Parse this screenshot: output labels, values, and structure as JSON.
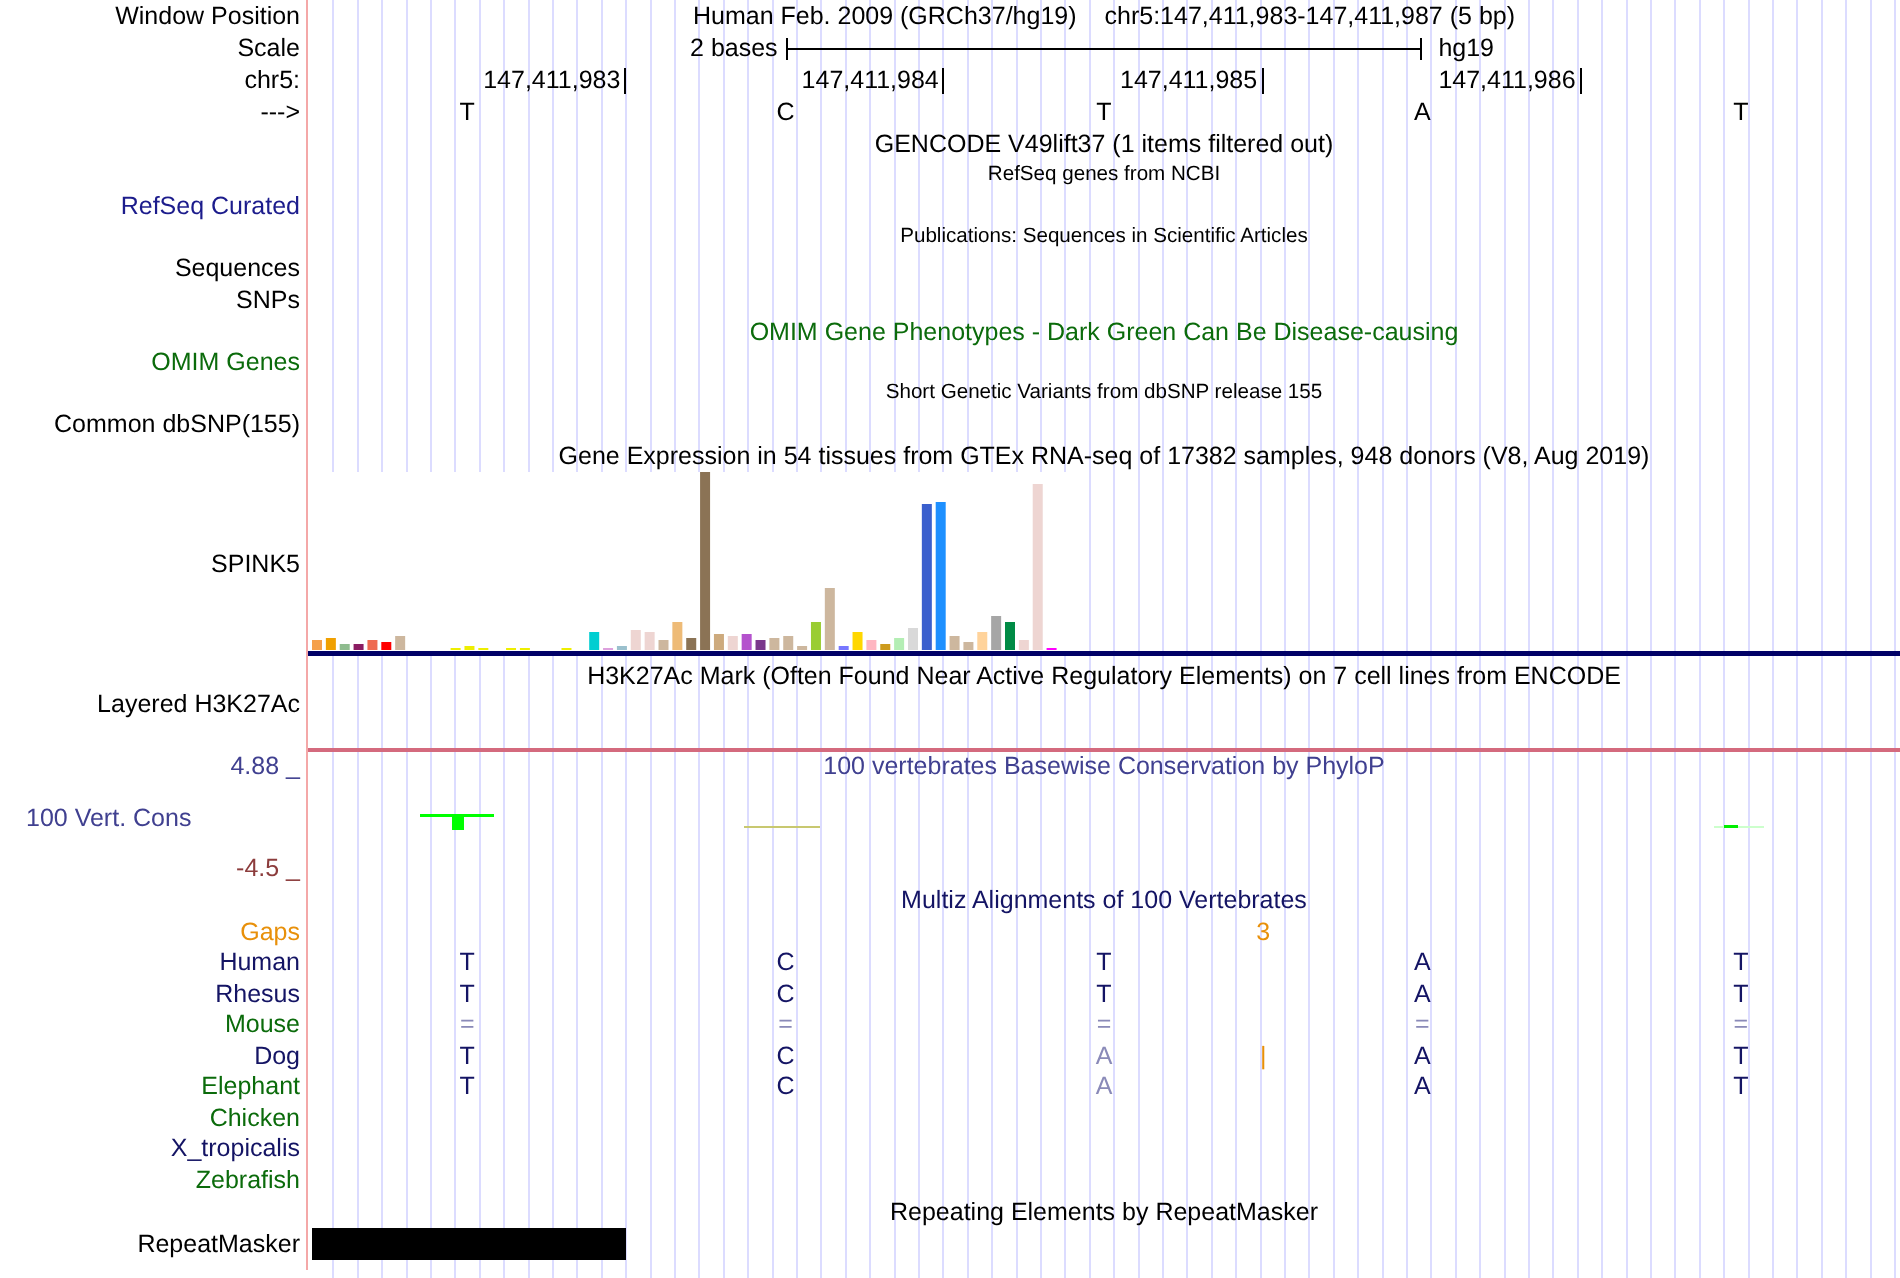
{
  "header": {
    "label": "Window Position",
    "assembly": "Human Feb. 2009 (GRCh37/hg19)",
    "range": "chr5:147,411,983-147,411,987 (5 bp)"
  },
  "scale": {
    "label": "Scale",
    "span": "2 bases",
    "db": "hg19"
  },
  "ruler": {
    "label": "chr5:",
    "positions": [
      "147,411,983",
      "147,411,984",
      "147,411,985",
      "147,411,986"
    ]
  },
  "strand": {
    "label": "--->",
    "bases": [
      "T",
      "C",
      "T",
      "A",
      "T"
    ]
  },
  "rows": [
    {
      "kind": "title",
      "text": "GENCODE V49lift37 (1 items filtered out)",
      "color": "#000000"
    },
    {
      "kind": "note",
      "text": "RefSeq genes from NCBI"
    },
    {
      "kind": "label",
      "label": "RefSeq Curated",
      "color": "#1c1c8c"
    },
    {
      "kind": "note",
      "text": "Publications: Sequences in Scientific Articles"
    },
    {
      "kind": "label",
      "label": "Sequences",
      "color": "#000000"
    },
    {
      "kind": "label",
      "label": "SNPs",
      "color": "#000000"
    },
    {
      "kind": "title",
      "text": "OMIM Gene Phenotypes - Dark Green Can Be Disease-causing",
      "color": "#0b6b0b"
    },
    {
      "kind": "label",
      "label": "OMIM Genes",
      "color": "#0b6b0b"
    },
    {
      "kind": "note",
      "text": "Short Genetic Variants from dbSNP release 155"
    },
    {
      "kind": "label",
      "label": "Common dbSNP(155)",
      "color": "#000000"
    },
    {
      "kind": "title",
      "text": "Gene Expression in 54 tissues from GTEx RNA-seq of 17382 samples, 948 donors (V8, Aug 2019)",
      "color": "#000000"
    },
    {
      "kind": "expression",
      "label": "SPINK5"
    },
    {
      "kind": "layered",
      "label": "Layered H3K27Ac",
      "text": "H3K27Ac Mark (Often Found Near Active Regulatory Elements) on 7 cell lines from ENCODE"
    },
    {
      "kind": "conservation",
      "label": "100 Vert. Cons",
      "text": "100 vertebrates Basewise Conservation by PhyloP",
      "max": "4.88 _",
      "min": "-4.5 _"
    },
    {
      "kind": "title",
      "text": "Multiz Alignments of 100 Vertebrates",
      "color": "#141464"
    },
    {
      "kind": "gaps",
      "label": "Gaps",
      "color": "#e8900a",
      "columns": [
        {
          "gap": false
        },
        {
          "gap": false
        },
        {
          "gap": true,
          "count": "3"
        },
        {
          "gap": false
        },
        {
          "gap": false
        }
      ]
    },
    {
      "kind": "species",
      "label": "Human",
      "color": "#141464",
      "bases": [
        {
          "base": "T",
          "faded": false
        },
        {
          "base": "C",
          "faded": false
        },
        {
          "base": "T",
          "faded": false
        },
        {
          "base": "A",
          "faded": false
        },
        {
          "base": "T",
          "faded": false
        }
      ]
    },
    {
      "kind": "species",
      "label": "Rhesus",
      "color": "#141464",
      "bases": [
        {
          "base": "T",
          "faded": false
        },
        {
          "base": "C",
          "faded": false
        },
        {
          "base": "T",
          "faded": false
        },
        {
          "base": "A",
          "faded": false
        },
        {
          "base": "T",
          "faded": false
        }
      ]
    },
    {
      "kind": "species",
      "label": "Mouse",
      "color": "#0b6b0b",
      "bases": [
        {
          "base": "=",
          "faded": true
        },
        {
          "base": "=",
          "faded": true
        },
        {
          "base": "=",
          "faded": true
        },
        {
          "base": "=",
          "faded": true
        },
        {
          "base": "=",
          "faded": true
        }
      ]
    },
    {
      "kind": "species",
      "label": "Dog",
      "color": "#141464",
      "bases": [
        {
          "base": "T",
          "faded": false
        },
        {
          "base": "C",
          "faded": false
        },
        {
          "base": "A",
          "faded": true,
          "insertion": "|"
        },
        {
          "base": "A",
          "faded": false
        },
        {
          "base": "T",
          "faded": false
        }
      ]
    },
    {
      "kind": "species",
      "label": "Elephant",
      "color": "#0b6b0b",
      "bases": [
        {
          "base": "T",
          "faded": false
        },
        {
          "base": "C",
          "faded": false
        },
        {
          "base": "A",
          "faded": true
        },
        {
          "base": "A",
          "faded": false
        },
        {
          "base": "T",
          "faded": false
        }
      ]
    },
    {
      "kind": "species",
      "label": "Chicken",
      "color": "#0b6b0b"
    },
    {
      "kind": "species",
      "label": "X_tropicalis",
      "color": "#141464"
    },
    {
      "kind": "species",
      "label": "Zebrafish",
      "color": "#0b6b0b"
    },
    {
      "kind": "title",
      "text": "Repeating Elements by RepeatMasker",
      "color": "#000000"
    },
    {
      "kind": "repeat",
      "label": "RepeatMasker",
      "covered": [
        true,
        false,
        false,
        false,
        false
      ]
    }
  ]
}
